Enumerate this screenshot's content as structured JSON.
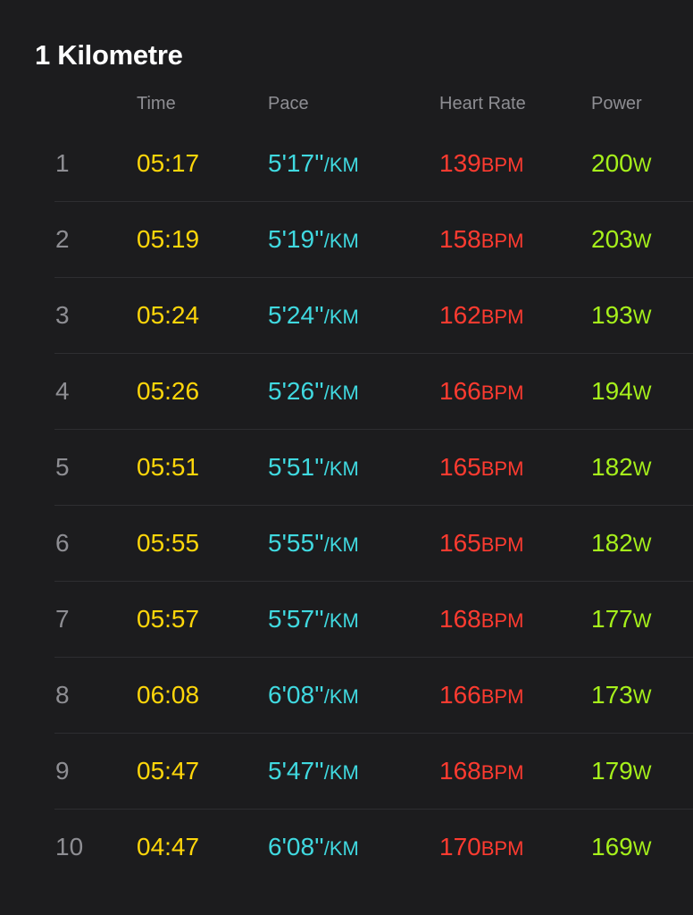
{
  "section_title": "1 Kilometre",
  "columns": {
    "time": "Time",
    "pace": "Pace",
    "heart_rate": "Heart Rate",
    "power": "Power"
  },
  "units": {
    "pace": "/KM",
    "heart_rate": "BPM",
    "power": "W"
  },
  "colors": {
    "background": "#1c1c1e",
    "time": "#ffd60a",
    "pace": "#40d9e0",
    "heart_rate": "#ff3b30",
    "power": "#a6f01b",
    "label": "#8e8e93"
  },
  "splits": [
    {
      "index": "1",
      "time": "05:17",
      "pace": "5'17''",
      "heart_rate": "139",
      "power": "200"
    },
    {
      "index": "2",
      "time": "05:19",
      "pace": "5'19''",
      "heart_rate": "158",
      "power": "203"
    },
    {
      "index": "3",
      "time": "05:24",
      "pace": "5'24''",
      "heart_rate": "162",
      "power": "193"
    },
    {
      "index": "4",
      "time": "05:26",
      "pace": "5'26''",
      "heart_rate": "166",
      "power": "194"
    },
    {
      "index": "5",
      "time": "05:51",
      "pace": "5'51''",
      "heart_rate": "165",
      "power": "182"
    },
    {
      "index": "6",
      "time": "05:55",
      "pace": "5'55''",
      "heart_rate": "165",
      "power": "182"
    },
    {
      "index": "7",
      "time": "05:57",
      "pace": "5'57''",
      "heart_rate": "168",
      "power": "177"
    },
    {
      "index": "8",
      "time": "06:08",
      "pace": "6'08''",
      "heart_rate": "166",
      "power": "173"
    },
    {
      "index": "9",
      "time": "05:47",
      "pace": "5'47''",
      "heart_rate": "168",
      "power": "179"
    },
    {
      "index": "10",
      "time": "04:47",
      "pace": "6'08''",
      "heart_rate": "170",
      "power": "169"
    }
  ]
}
